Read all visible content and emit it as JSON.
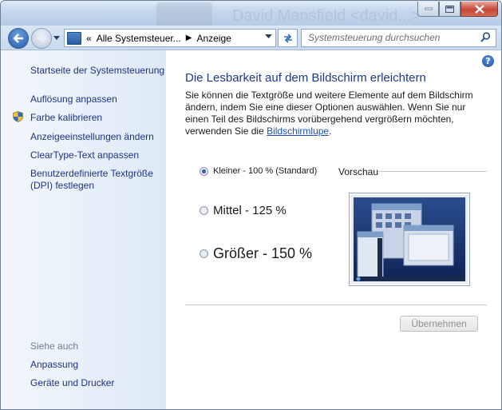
{
  "titlebar": {
    "ghost_text": "David Mansfield <david...>",
    "minimize_icon": "minimize-icon",
    "maximize_icon": "maximize-icon",
    "close_icon": "close-icon"
  },
  "addressbar": {
    "overflow": "«",
    "crumbs": [
      "Alle Systemsteuer...",
      "Anzeige"
    ],
    "search_placeholder": "Systemsteuerung durchsuchen"
  },
  "sidebar": {
    "home": "Startseite der Systemsteuerung",
    "links": [
      "Auflösung anpassen",
      "Farbe kalibrieren",
      "Anzeigeeinstellungen ändern",
      "ClearType-Text anpassen",
      "Benutzerdefinierte Textgröße (DPI) festlegen"
    ],
    "see_also_label": "Siehe auch",
    "see_also": [
      "Anpassung",
      "Geräte und Drucker"
    ]
  },
  "main": {
    "heading": "Die Lesbarkeit auf dem Bildschirm erleichtern",
    "description": "Sie können die Textgröße und weitere Elemente auf dem Bildschirm ändern, indem Sie eine dieser Optionen auswählen. Wenn Sie nur einen Teil des Bildschirms vorübergehend vergrößern möchten, verwenden Sie die",
    "magnifier_link": "Bildschirmlupe",
    "description_end": ".",
    "options": [
      {
        "label": "Kleiner - 100 % (Standard)",
        "selected": true
      },
      {
        "label": "Mittel - 125 %",
        "selected": false
      },
      {
        "label": "Größer - 150 %",
        "selected": false
      }
    ],
    "preview_label": "Vorschau",
    "apply_button": "Übernehmen",
    "help_icon": "?"
  },
  "colors": {
    "accent": "#1e3a8a",
    "link": "#1e3287",
    "sidebar_bg": "#dce9f6"
  }
}
